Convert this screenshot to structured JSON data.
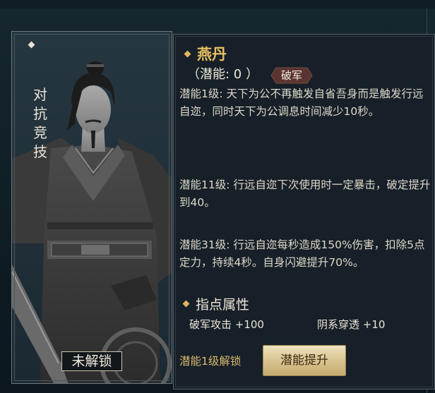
{
  "card": {
    "vertical_title": [
      "对",
      "抗",
      "竞",
      "技"
    ],
    "status_label": "未解锁"
  },
  "skill": {
    "name": "燕丹",
    "potential": "（潜能: 0 ）",
    "tag": "破军",
    "descriptions": [
      "潜能1级: 天下为公不再触发自省吾身而是触发行远自迩，同时天下为公调息时间减少10秒。",
      "潜能11级: 行远自迩下次使用时一定暴击，破定提升到40。",
      "潜能31级: 行远自迩每秒造成150%伤害，扣除5点定力，持续4秒。自身闪避提升70%。"
    ]
  },
  "attributes": {
    "title": "指点属性",
    "items": [
      "破军攻击 +100",
      "阴系穿透 +10"
    ]
  },
  "footer": {
    "unlock_hint": "潜能1级解锁",
    "upgrade_label": "潜能提升"
  },
  "colors": {
    "accent_gold": "#e8c060",
    "tag_bg": "#5a3430"
  }
}
